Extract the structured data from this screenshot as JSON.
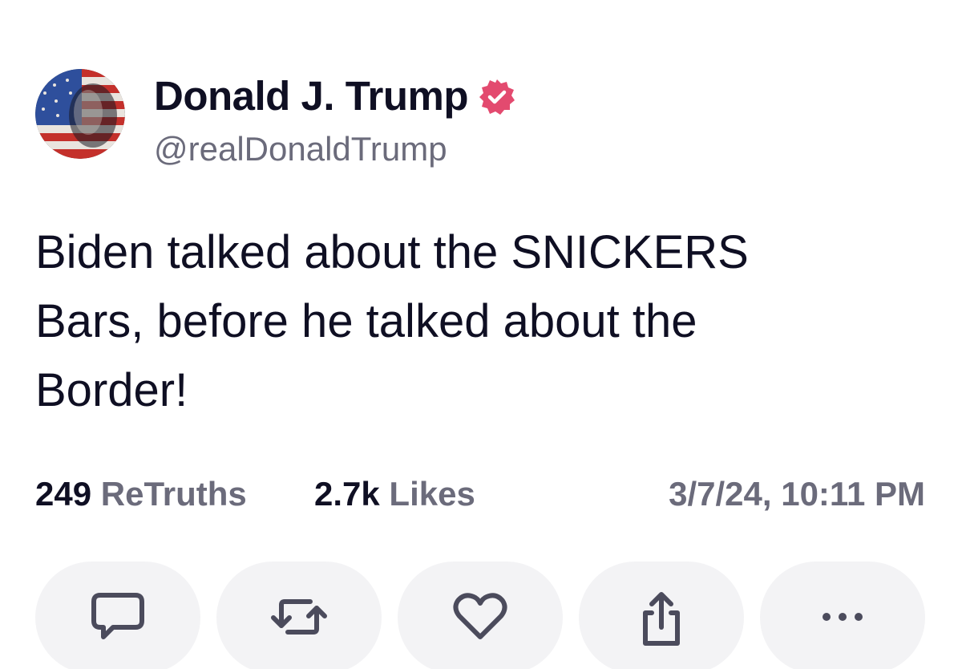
{
  "author": {
    "display_name": "Donald J. Trump",
    "handle": "@realDonaldTrump",
    "verified": true,
    "verified_badge_color": "#e34a6f"
  },
  "post": {
    "text": "Biden talked about the SNICKERS\nBars, before he talked about the\nBorder!"
  },
  "stats": {
    "retruths_count": "249",
    "retruths_label": "ReTruths",
    "likes_count": "2.7k",
    "likes_label": "Likes",
    "timestamp": "3/7/24, 10:11 PM"
  },
  "actions": [
    {
      "name": "reply",
      "icon": "comment-icon"
    },
    {
      "name": "retruth",
      "icon": "repost-icon"
    },
    {
      "name": "like",
      "icon": "heart-icon"
    },
    {
      "name": "share",
      "icon": "share-icon"
    },
    {
      "name": "more",
      "icon": "more-icon"
    }
  ],
  "colors": {
    "text_primary": "#0f0f23",
    "text_secondary": "#6b6b7b",
    "button_bg": "#f3f3f5",
    "icon": "#4b4b5c"
  }
}
